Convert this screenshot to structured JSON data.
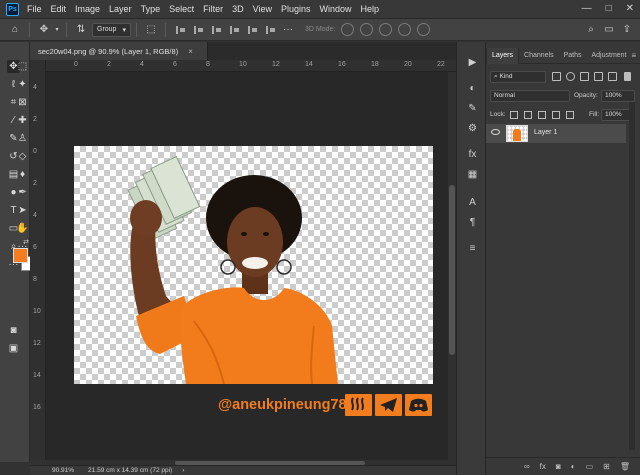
{
  "menu": [
    "File",
    "Edit",
    "Image",
    "Layer",
    "Type",
    "Select",
    "Filter",
    "3D",
    "View",
    "Plugins",
    "Window",
    "Help"
  ],
  "window_controls": [
    "—",
    "□",
    "✕"
  ],
  "options": {
    "group_select": "Group",
    "mode_3d": "3D Mode:"
  },
  "document_tab": {
    "title": "sec20w04.png @ 90.9% (Layer 1, RGB/8)",
    "close": "×"
  },
  "ruler_top_ticks": [
    "0",
    "2",
    "4",
    "6",
    "8",
    "10",
    "12",
    "14",
    "16",
    "18",
    "20",
    "22"
  ],
  "ruler_left_ticks": [
    "4",
    "2",
    "0",
    "2",
    "4",
    "6",
    "8",
    "10",
    "12",
    "14",
    "16"
  ],
  "watermark": {
    "text": "@aneukpineung78",
    "icons": [
      "steemit-icon",
      "telegram-icon",
      "discord-icon"
    ],
    "color": "#f27d1e"
  },
  "colors": {
    "foreground": "#f47e1f",
    "background": "#ffffff"
  },
  "status": {
    "zoom": "90.91%",
    "doc_info": "21.59 cm x 14.39 cm (72 ppi)",
    "arrow": "›"
  },
  "layers_panel": {
    "tabs": [
      "Layers",
      "Channels",
      "Paths",
      "Adjustment"
    ],
    "kind_label": "Kind",
    "blend_mode": "Normal",
    "opacity_label": "Opacity:",
    "opacity_value": "100%",
    "lock_label": "Lock:",
    "fill_label": "Fill:",
    "fill_value": "100%",
    "layers": [
      {
        "name": "Layer 1",
        "visible": true
      }
    ]
  }
}
